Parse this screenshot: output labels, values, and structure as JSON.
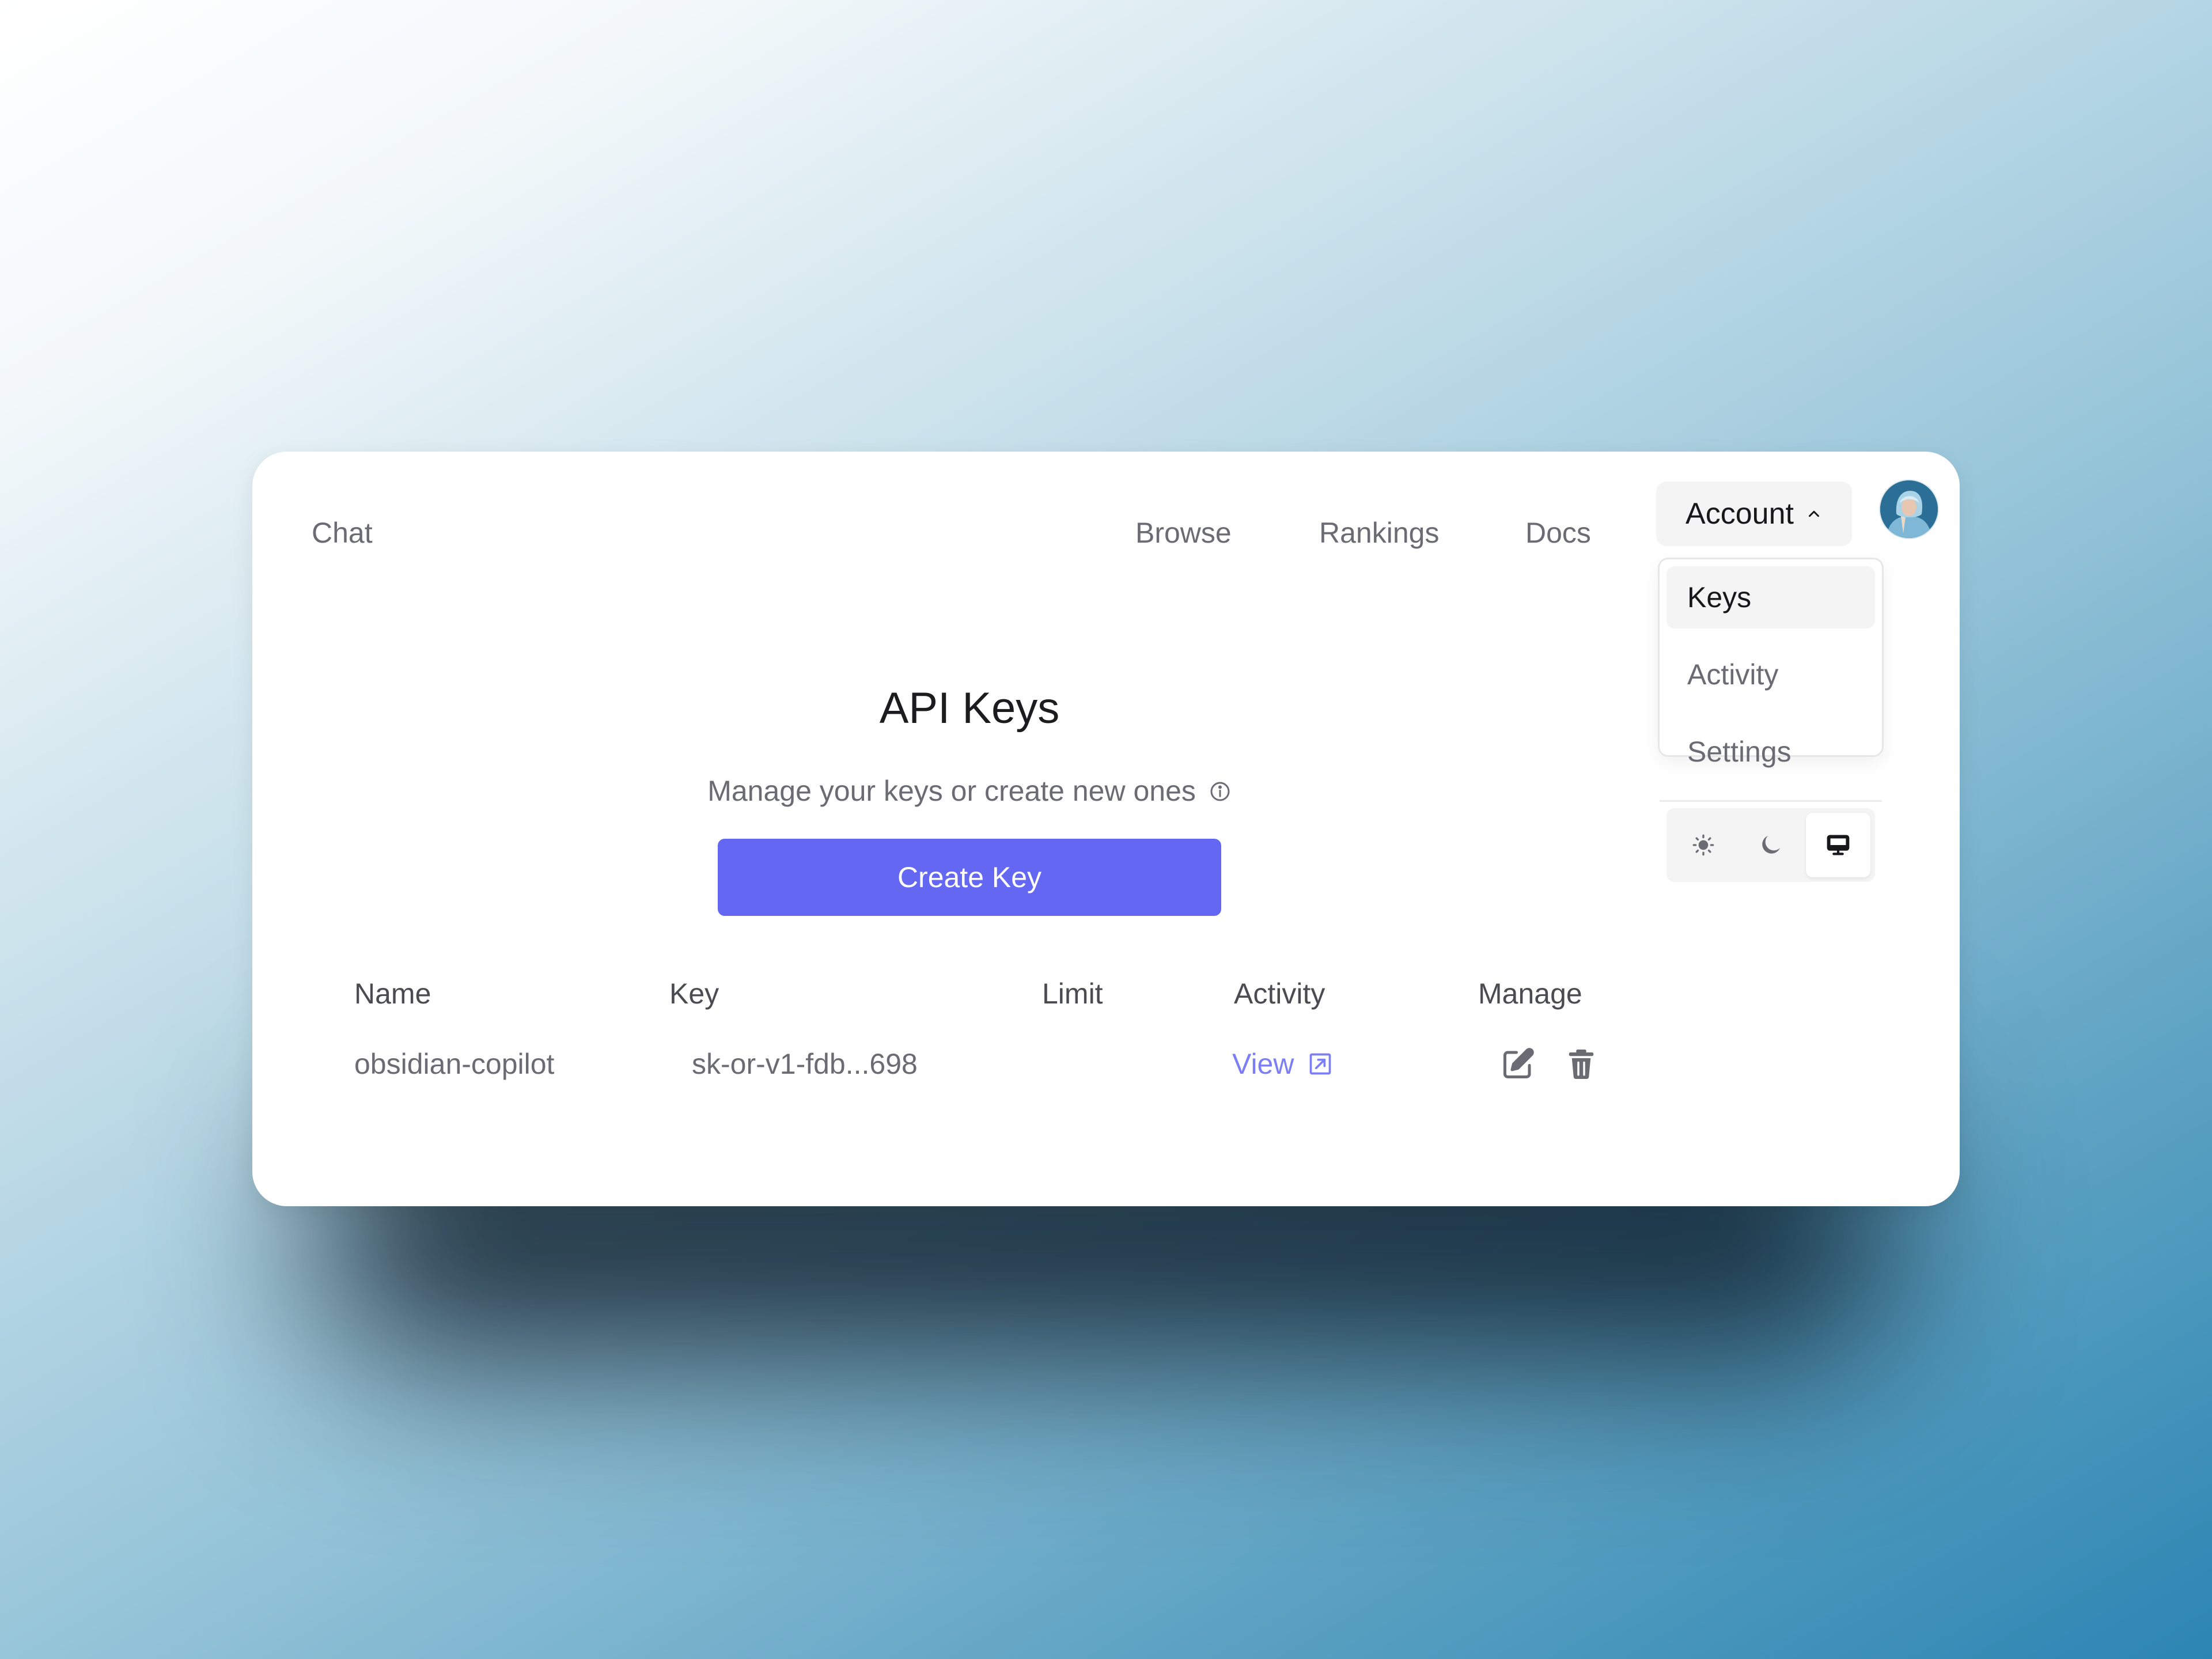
{
  "nav": {
    "chat": "Chat",
    "browse": "Browse",
    "rankings": "Rankings",
    "docs": "Docs",
    "account": "Account"
  },
  "account_menu": {
    "items": [
      {
        "label": "Keys",
        "active": true
      },
      {
        "label": "Activity",
        "active": false
      },
      {
        "label": "Settings",
        "active": false
      }
    ],
    "theme_options": [
      "light",
      "dark",
      "system"
    ],
    "selected_theme": "system"
  },
  "page": {
    "title": "API Keys",
    "subtitle": "Manage your keys or create new ones",
    "create_button": "Create Key"
  },
  "table": {
    "headers": [
      "Name",
      "Key",
      "Limit",
      "Activity",
      "Manage"
    ],
    "rows": [
      {
        "name": "obsidian-copilot",
        "key": "sk-or-v1-fdb...698",
        "limit": "",
        "activity_link": "View"
      }
    ]
  },
  "icons": {
    "account_chevron": "chevron-up-icon",
    "info": "info-icon",
    "theme_light": "sun-icon",
    "theme_dark": "moon-icon",
    "theme_system": "monitor-icon",
    "external_link": "external-link-icon",
    "edit": "edit-icon",
    "delete": "trash-icon"
  },
  "colors": {
    "accent": "#6467f2",
    "link": "#7b7ef5",
    "text_primary": "#18181b",
    "text_muted": "#6b6b74",
    "menu_active_bg": "#f4f4f5"
  }
}
